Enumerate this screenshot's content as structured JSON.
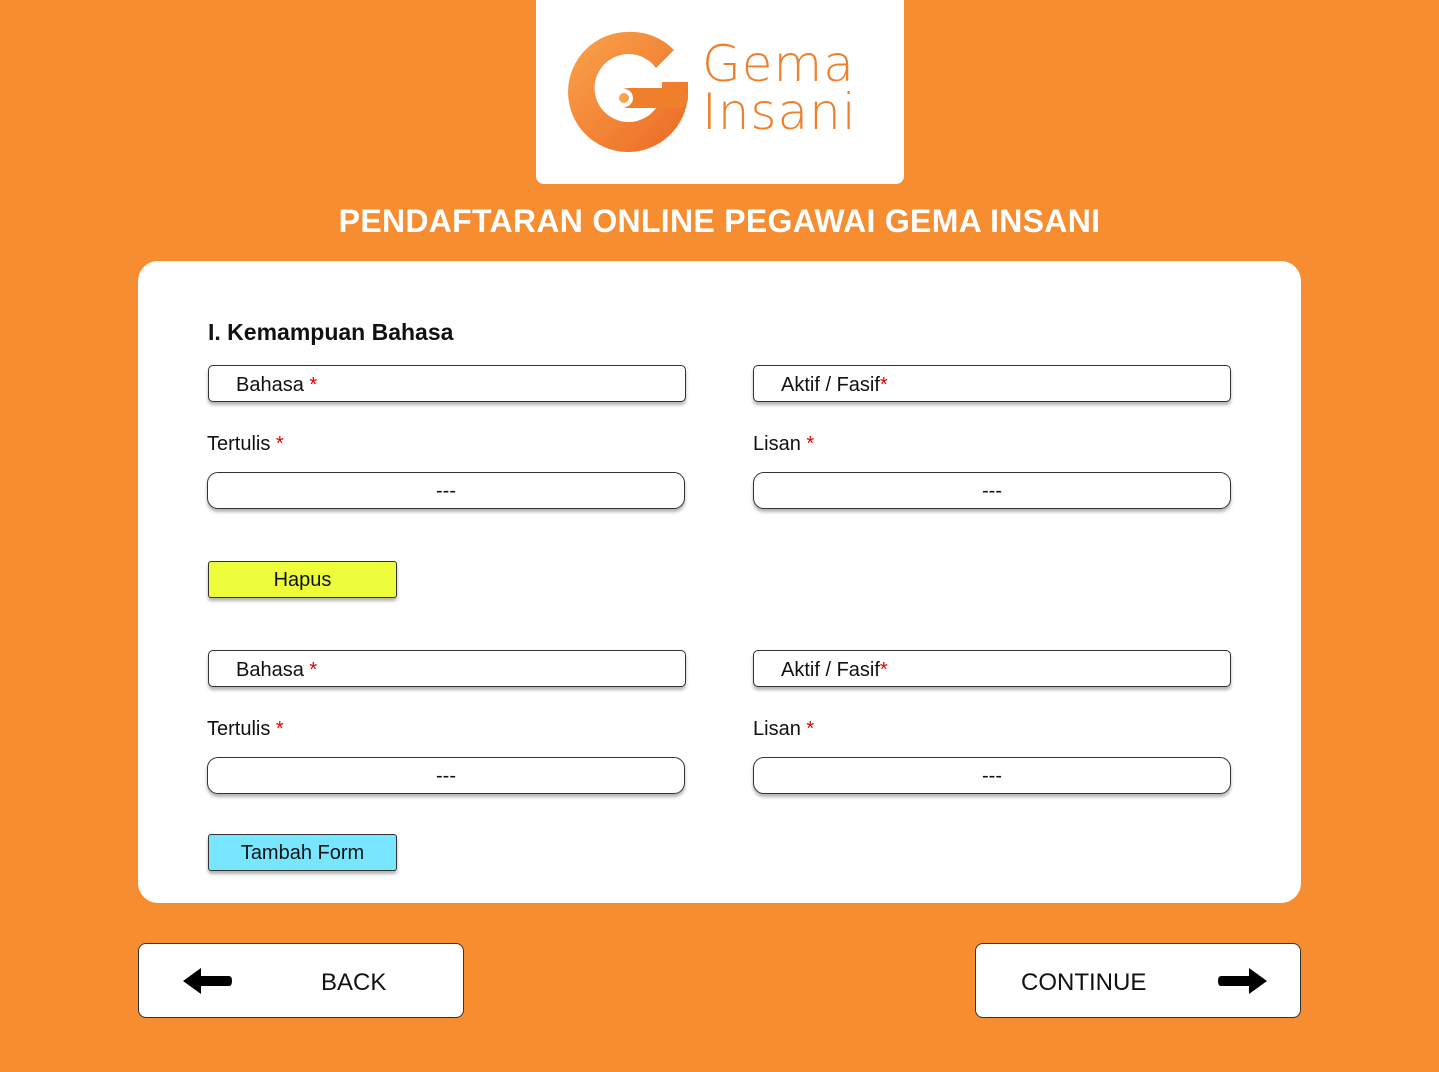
{
  "brand": {
    "line1": "Gema",
    "line2": "Insani",
    "orange": "#F07F2C",
    "orange_light": "#F9A34C"
  },
  "page_title": "PENDAFTARAN ONLINE PEGAWAI GEMA INSANI",
  "section": {
    "title": "I. Kemampuan Bahasa"
  },
  "forms": [
    {
      "bahasa_label": "Bahasa",
      "aktif_label": "Aktif / Fasif",
      "tertulis_label": "Tertulis",
      "tertulis_value": "---",
      "lisan_label": "Lisan",
      "lisan_value": "---"
    },
    {
      "bahasa_label": "Bahasa",
      "aktif_label": "Aktif / Fasif",
      "tertulis_label": "Tertulis",
      "tertulis_value": "---",
      "lisan_label": "Lisan",
      "lisan_value": "---"
    }
  ],
  "required_marker": "*",
  "buttons": {
    "hapus": "Hapus",
    "tambah": "Tambah Form",
    "back": "BACK",
    "continue": "CONTINUE"
  },
  "colors": {
    "background": "#F78D31",
    "hapus_bg": "#EDFD3B",
    "tambah_bg": "#78E6FF",
    "required": "#E00000"
  },
  "icons": {
    "back": "arrow-left-icon",
    "continue": "arrow-right-icon"
  }
}
